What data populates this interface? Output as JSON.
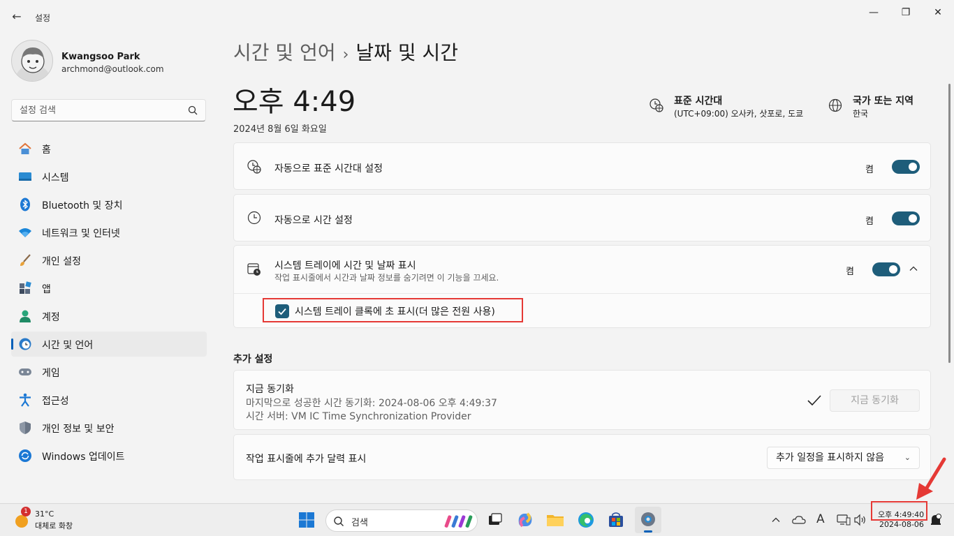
{
  "window": {
    "app_title": "설정",
    "back_icon": "back-arrow-icon",
    "controls": [
      "minimize-icon",
      "maximize-icon",
      "close-icon"
    ]
  },
  "user": {
    "name": "Kwangsoo Park",
    "email": "archmond@outlook.com"
  },
  "search": {
    "placeholder": "설정 검색",
    "icon": "search-icon"
  },
  "sidebar": {
    "items": [
      {
        "label": "홈",
        "icon": "home-icon"
      },
      {
        "label": "시스템",
        "icon": "system-icon"
      },
      {
        "label": "Bluetooth 및 장치",
        "icon": "bluetooth-icon"
      },
      {
        "label": "네트워크 및 인터넷",
        "icon": "wifi-icon"
      },
      {
        "label": "개인 설정",
        "icon": "brush-icon"
      },
      {
        "label": "앱",
        "icon": "apps-icon"
      },
      {
        "label": "계정",
        "icon": "account-icon"
      },
      {
        "label": "시간 및 언어",
        "icon": "time-language-icon",
        "active": true
      },
      {
        "label": "게임",
        "icon": "gaming-icon"
      },
      {
        "label": "접근성",
        "icon": "accessibility-icon"
      },
      {
        "label": "개인 정보 및 보안",
        "icon": "shield-icon"
      },
      {
        "label": "Windows 업데이트",
        "icon": "update-icon"
      }
    ]
  },
  "main": {
    "breadcrumb_parent": "시간 및 언어",
    "breadcrumb_sep": "›",
    "breadcrumb_current": "날짜 및 시간",
    "time": "오후 4:49",
    "date": "2024년 8월 6일 화요일",
    "timezone": {
      "title": "표준 시간대",
      "value": "(UTC+09:00) 오사카, 삿포로, 도쿄",
      "icon": "timezone-icon"
    },
    "region": {
      "title": "국가 또는 지역",
      "value": "한국",
      "icon": "globe-icon"
    },
    "settings": [
      {
        "label": "자동으로 표준 시간대 설정",
        "state": "켬",
        "icon": "timezone-auto-icon",
        "on": true
      },
      {
        "label": "자동으로 시간 설정",
        "state": "켬",
        "icon": "clock-icon",
        "on": true
      },
      {
        "label": "시스템 트레이에 시간 및 날짜 표시",
        "desc": "작업 표시줄에서 시간과 날짜 정보를 숨기려면 이 기능을 끄세요.",
        "state": "켬",
        "icon": "calendar-clock-icon",
        "on": true,
        "expanded": true
      }
    ],
    "seconds_option": {
      "label": "시스템 트레이 클록에 초 표시(더 많은 전원 사용)",
      "checked": true
    },
    "additional_title": "추가 설정",
    "sync": {
      "title": "지금 동기화",
      "last_sync": "마지막으로 성공한 시간 동기화: 2024-08-06 오후 4:49:37",
      "server": "시간 서버: VM IC Time Synchronization Provider",
      "button": "지금 동기화",
      "check_icon": "checkmark-icon"
    },
    "calendar": {
      "label": "작업 표시줄에 추가 달력 표시",
      "selected": "추가 일정을 표시하지 않음"
    }
  },
  "taskbar": {
    "weather": {
      "temp": "31°C",
      "desc": "대체로 화창",
      "badge": "1"
    },
    "search_label": "검색",
    "clock_time": "오후 4:49:40",
    "clock_date": "2024-08-06",
    "ime": "A"
  },
  "colors": {
    "accent": "#1e5d7a",
    "highlight": "#e53935",
    "nav_indicator": "#005fb8"
  }
}
